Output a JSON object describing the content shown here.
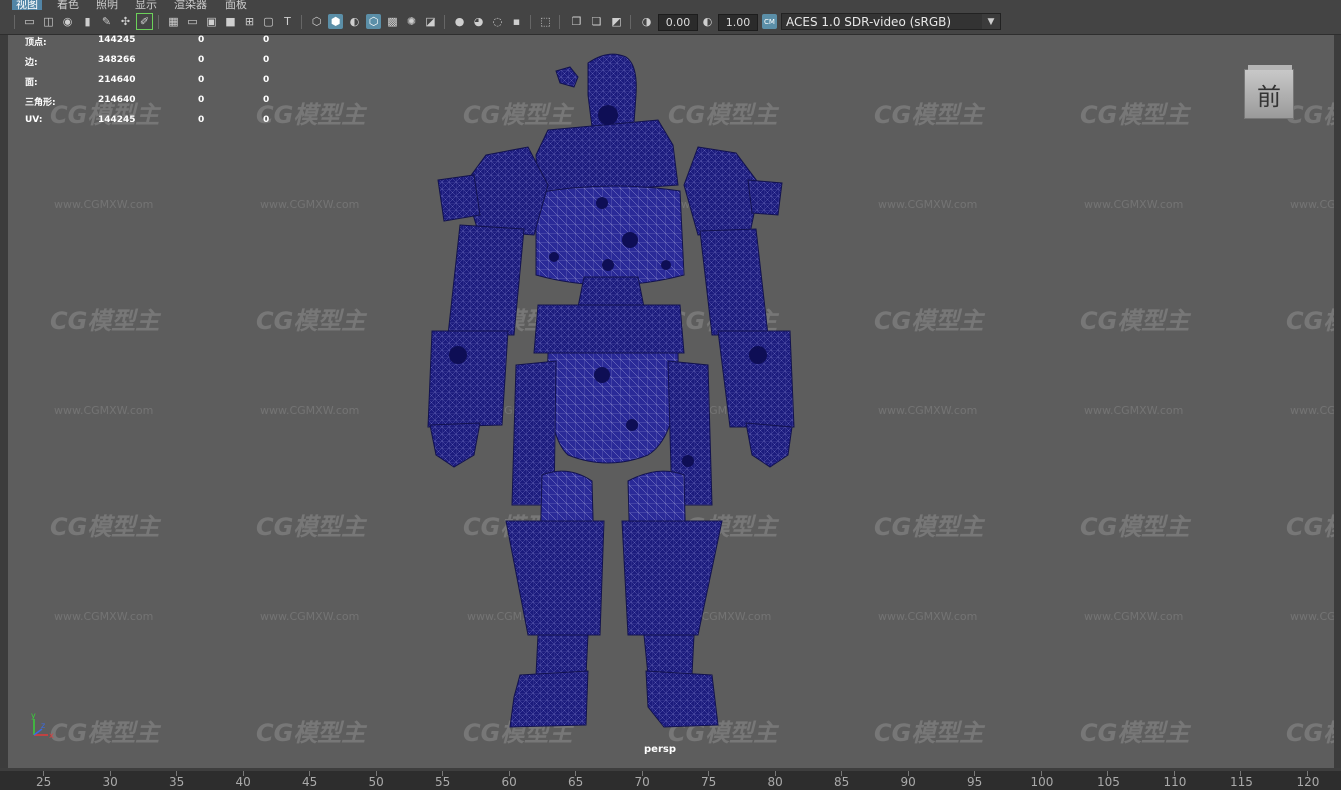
{
  "menu": [
    "视图",
    "着色",
    "照明",
    "显示",
    "渲染器",
    "面板"
  ],
  "toolbar": {
    "exposure_value": "0.00",
    "gamma_value": "1.00",
    "colorspace": "ACES 1.0 SDR-video (sRGB)",
    "colorspace_badge": "CM"
  },
  "hud": {
    "rows": [
      {
        "label": "顶点:",
        "value": "144245",
        "sel1": "0",
        "sel2": "0"
      },
      {
        "label": "边:",
        "value": "348266",
        "sel1": "0",
        "sel2": "0"
      },
      {
        "label": "面:",
        "value": "214640",
        "sel1": "0",
        "sel2": "0"
      },
      {
        "label": "三角形:",
        "value": "214640",
        "sel1": "0",
        "sel2": "0"
      },
      {
        "label": "UV:",
        "value": "144245",
        "sel1": "0",
        "sel2": "0"
      }
    ]
  },
  "viewcube": {
    "face_label": "前"
  },
  "viewport": {
    "camera_label": "persp",
    "wireframe_color": "#1f1f86",
    "watermark_logo": "CG模型主",
    "watermark_url": "www.CGMXW.com"
  },
  "axis": {
    "x": "x",
    "y": "y",
    "z": "z"
  },
  "timeline": {
    "ticks": [
      "25",
      "30",
      "35",
      "40",
      "45",
      "50",
      "55",
      "60",
      "65",
      "70",
      "75",
      "80",
      "85",
      "90",
      "95",
      "100",
      "105",
      "110",
      "115",
      "120"
    ]
  }
}
